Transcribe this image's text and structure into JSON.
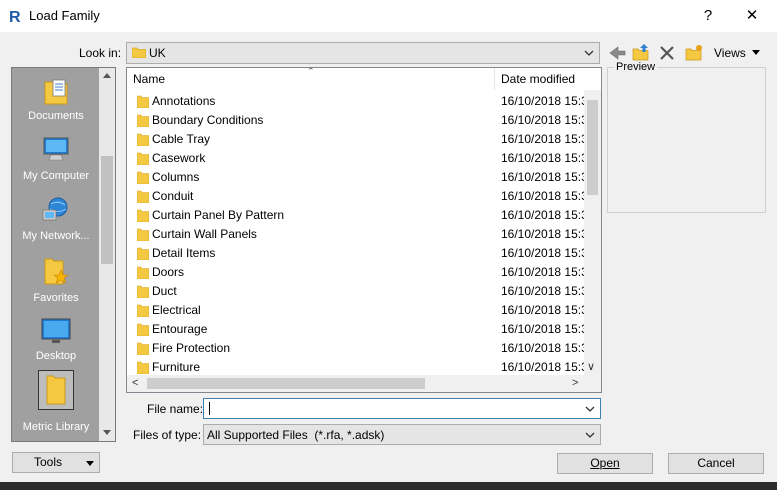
{
  "window": {
    "title": "Load Family",
    "help_label": "?",
    "close_label": "✕"
  },
  "lookin": {
    "label": "Look in:",
    "value": "UK"
  },
  "toolbar": {
    "views_label": "Views"
  },
  "preview": {
    "label": "Preview"
  },
  "places": [
    {
      "label": "Documents",
      "icon": "documents-icon"
    },
    {
      "label": "My Computer",
      "icon": "computer-icon"
    },
    {
      "label": "My Network...",
      "icon": "network-icon"
    },
    {
      "label": "Favorites",
      "icon": "favorites-icon"
    },
    {
      "label": "Desktop",
      "icon": "desktop-icon"
    },
    {
      "label": "Metric Library",
      "icon": "folder-icon"
    }
  ],
  "filelist": {
    "col_name": "Name",
    "col_date": "Date modified",
    "rows": [
      {
        "name": "Annotations",
        "date": "16/10/2018 15:3"
      },
      {
        "name": "Boundary Conditions",
        "date": "16/10/2018 15:3"
      },
      {
        "name": "Cable Tray",
        "date": "16/10/2018 15:3"
      },
      {
        "name": "Casework",
        "date": "16/10/2018 15:3"
      },
      {
        "name": "Columns",
        "date": "16/10/2018 15:3"
      },
      {
        "name": "Conduit",
        "date": "16/10/2018 15:3"
      },
      {
        "name": "Curtain Panel By Pattern",
        "date": "16/10/2018 15:3"
      },
      {
        "name": "Curtain Wall Panels",
        "date": "16/10/2018 15:3"
      },
      {
        "name": "Detail Items",
        "date": "16/10/2018 15:3"
      },
      {
        "name": "Doors",
        "date": "16/10/2018 15:3"
      },
      {
        "name": "Duct",
        "date": "16/10/2018 15:3"
      },
      {
        "name": "Electrical",
        "date": "16/10/2018 15:3"
      },
      {
        "name": "Entourage",
        "date": "16/10/2018 15:3"
      },
      {
        "name": "Fire Protection",
        "date": "16/10/2018 15:3"
      },
      {
        "name": "Furniture",
        "date": "16/10/2018 15:3"
      }
    ]
  },
  "form": {
    "filename_label": "File name:",
    "filename_value": "",
    "filetype_label": "Files of type:",
    "filetype_value": "All Supported Files  (*.rfa, *.adsk)"
  },
  "buttons": {
    "tools": "Tools",
    "open": "Open",
    "cancel": "Cancel"
  },
  "colors": {
    "accent": "#3c7fb1",
    "folder": "#f5c842"
  }
}
